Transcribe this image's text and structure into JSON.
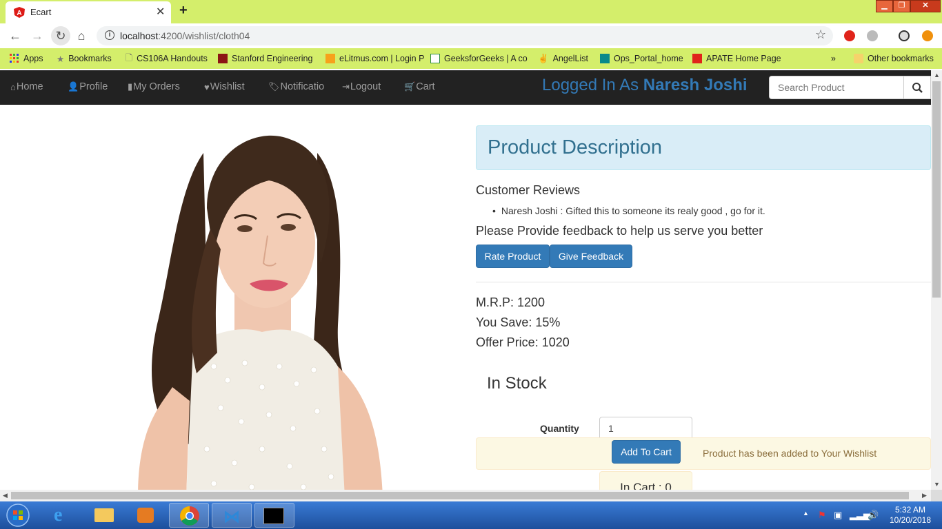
{
  "browser": {
    "tab_title": "Ecart",
    "url_host": "localhost",
    "url_path": ":4200/wishlist/cloth04",
    "bookmarks": [
      {
        "label": "Apps"
      },
      {
        "label": "Bookmarks"
      },
      {
        "label": "CS106A Handouts"
      },
      {
        "label": "Stanford Engineering"
      },
      {
        "label": "eLitmus.com | Login P"
      },
      {
        "label": "GeeksforGeeks | A co"
      },
      {
        "label": "AngelList"
      },
      {
        "label": "Ops_Portal_home"
      },
      {
        "label": "APATE Home Page"
      }
    ],
    "overflow_chevron": "»",
    "other_bookmarks": "Other bookmarks"
  },
  "navbar": {
    "items": [
      {
        "label": "Home",
        "icon": "home-icon"
      },
      {
        "label": "Profile",
        "icon": "user-icon"
      },
      {
        "label": "My Orders",
        "icon": "book-icon"
      },
      {
        "label": "Wishlist",
        "icon": "heart-icon"
      },
      {
        "label": "Notificatio",
        "icon": "tags-icon"
      },
      {
        "label": "Logout",
        "icon": "logout-icon"
      },
      {
        "label": "Cart",
        "icon": "cart-icon"
      }
    ],
    "logged_prefix": "Logged In As ",
    "logged_user": "Naresh Joshi",
    "search_placeholder": "Search Product"
  },
  "product": {
    "panel_title": "Product Description",
    "reviews_heading": "Customer Reviews",
    "reviews": [
      {
        "text": "Naresh Joshi : Gifted this to someone its realy good , go for it."
      }
    ],
    "feedback_heading": "Please Provide feedback to help us serve you better",
    "rate_button": "Rate Product",
    "feedback_button": "Give Feedback",
    "mrp": "M.R.P: 1200",
    "you_save": "You Save: 15%",
    "offer_price": "Offer Price: 1020",
    "stock": "In Stock",
    "quantity_label": "Quantity",
    "quantity_value": "1",
    "add_to_cart": "Add To Cart",
    "wishlist_message": "Product has been added to Your Wishlist",
    "in_cart": "In Cart : 0"
  },
  "taskbar": {
    "time": "5:32 AM",
    "date": "10/20/2018"
  },
  "colors": {
    "chrome_bar": "#d4ee6b",
    "navbar": "#222222",
    "brand_blue": "#337ab7",
    "panel_info_bg": "#d9edf7",
    "alert_warning_bg": "#fcf8e3"
  }
}
